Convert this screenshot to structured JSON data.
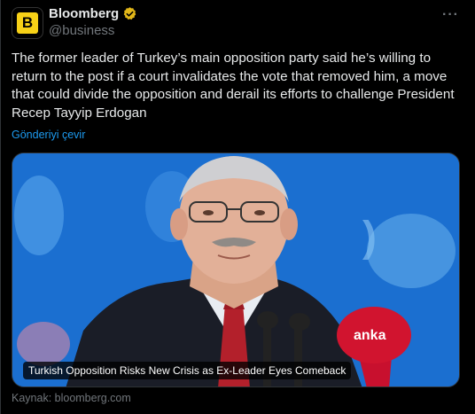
{
  "author": {
    "display_name": "Bloomberg",
    "handle": "@business",
    "avatar_letter": "B",
    "verified_color": "#e2b719"
  },
  "tweet": {
    "text": "The former leader of Turkey’s main opposition party said he’s willing to return to the post if a court invalidates the vote that removed him, a move that could divide the opposition and derail its efforts to challenge President Recep Tayyip Erdogan",
    "translate_label": "Gönderiyi çevir",
    "more_icon": "more-horizontal-icon"
  },
  "card": {
    "caption": "Turkish Opposition Risks New Crisis as Ex-Leader Eyes Comeback",
    "source_label": "Kaynak: bloomberg.com"
  },
  "colors": {
    "background": "#000000",
    "text": "#e7e9ea",
    "muted": "#71767b",
    "link": "#1d9bf0",
    "brand": "#f7d117"
  }
}
